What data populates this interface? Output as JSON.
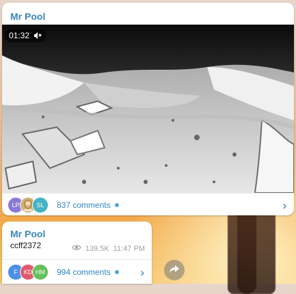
{
  "post1": {
    "author": "Mr Pool",
    "video": {
      "duration": "01:32",
      "muted_icon": "speaker-muted-icon"
    },
    "comments": {
      "avatars": [
        {
          "initials": "LP",
          "color": "#8b79d6"
        },
        {
          "initials": "",
          "color": "#d2b07a"
        },
        {
          "initials": "SL",
          "color": "#43b3c5"
        }
      ],
      "label": "837 comments"
    }
  },
  "post2": {
    "author": "Mr Pool",
    "text": "ccff2372",
    "views": "139.5K",
    "time": "11:47 PM",
    "comments": {
      "avatars": [
        {
          "initials": "F",
          "color": "#4b8fe6"
        },
        {
          "initials": "KD",
          "color": "#e05a6d"
        },
        {
          "initials": "HM",
          "color": "#63c05a"
        }
      ],
      "label": "994 comments"
    }
  },
  "icons": {
    "chevron": "chevron-right-icon",
    "views": "eye-icon",
    "share": "share-icon",
    "dot": "unread-dot-icon"
  }
}
